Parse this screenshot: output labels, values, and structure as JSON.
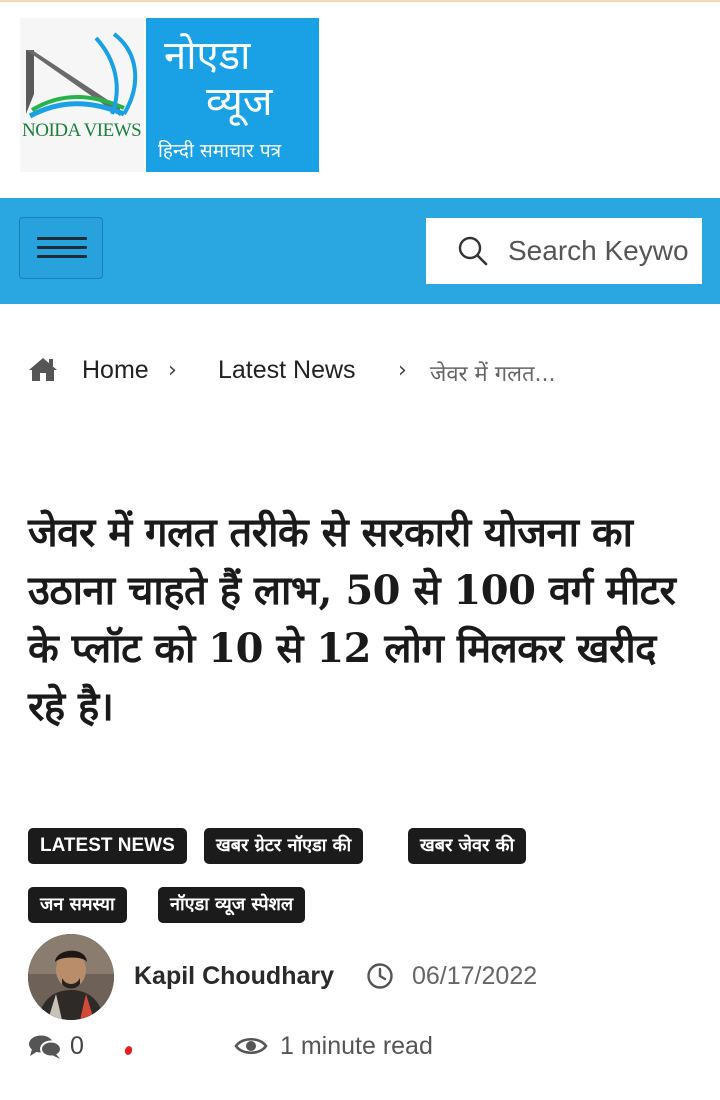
{
  "logo": {
    "left_text": "NOIDA VIEWS",
    "right_line1": "नोएडा",
    "right_line2": "व्यूज",
    "right_tagline": "हिन्दी समाचार पत्र",
    "brand_color": "#1aa0e4"
  },
  "header": {
    "bar_color": "#2aa6e0",
    "search_placeholder": "Search Keywo"
  },
  "breadcrumb": {
    "home": "Home",
    "category": "Latest News",
    "current": "जेवर में गलत..."
  },
  "article": {
    "title": "जेवर में गलत तरीके से सरकारी योजना का उठाना चाहते हैं लाभ, 50 से 100 वर्ग मीटर के प्लॉट को 10 से 12 लोग मिलकर खरीद रहे है।",
    "tags": [
      "LATEST NEWS",
      "खबर ग्रेटर नॉएडा की",
      "खबर जेवर की",
      "जन समस्या",
      "नॉएडा व्यूज स्पेशल"
    ],
    "author": "Kapil Choudhary",
    "date": "06/17/2022",
    "comments": "0",
    "read_time": "1 minute read"
  }
}
